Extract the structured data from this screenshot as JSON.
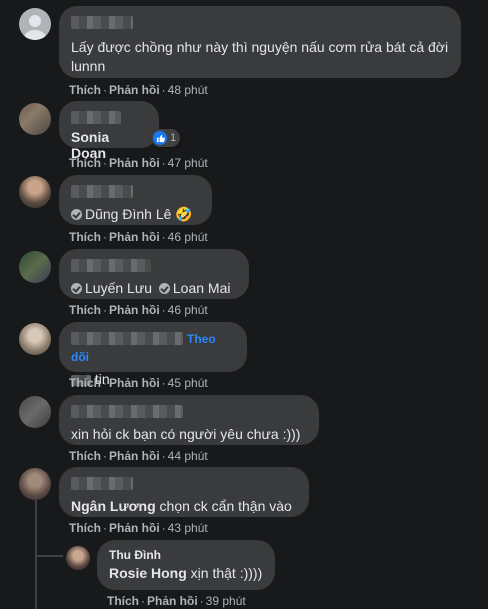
{
  "comments": [
    {
      "text": "Lấy được chồng như này thì nguyện nấu cơm rửa bát cả đời lunnn",
      "time": "48 phút"
    },
    {
      "author": "Sonia Doan",
      "reaction_count": "1",
      "time": "47 phút"
    },
    {
      "tag": "Dũng Đình Lê",
      "emoji": "🤣",
      "time": "46 phút"
    },
    {
      "tags": [
        "Luyến Lưu",
        "Loan Mai"
      ],
      "time": "46 phút"
    },
    {
      "follow": "Theo dõi",
      "text": "tin.",
      "time": "45 phút"
    },
    {
      "text": "xin hỏi ck bạn có người yêu chưa :)))",
      "time": "44 phút"
    },
    {
      "tag": "Ngân Lương",
      "text": " chọn ck cẩn thận vào",
      "time": "43 phút"
    },
    {
      "author": "Thu Đình",
      "tag": "Rosie Hong",
      "text": " xịn thật :))))",
      "time": "39 phút"
    }
  ],
  "labels": {
    "like": "Thích",
    "reply": "Phản hồi"
  },
  "colors": {
    "background": "#18191a",
    "bubble": "#3a3b3c",
    "link": "#2d88ff",
    "like": "#1877f2"
  }
}
